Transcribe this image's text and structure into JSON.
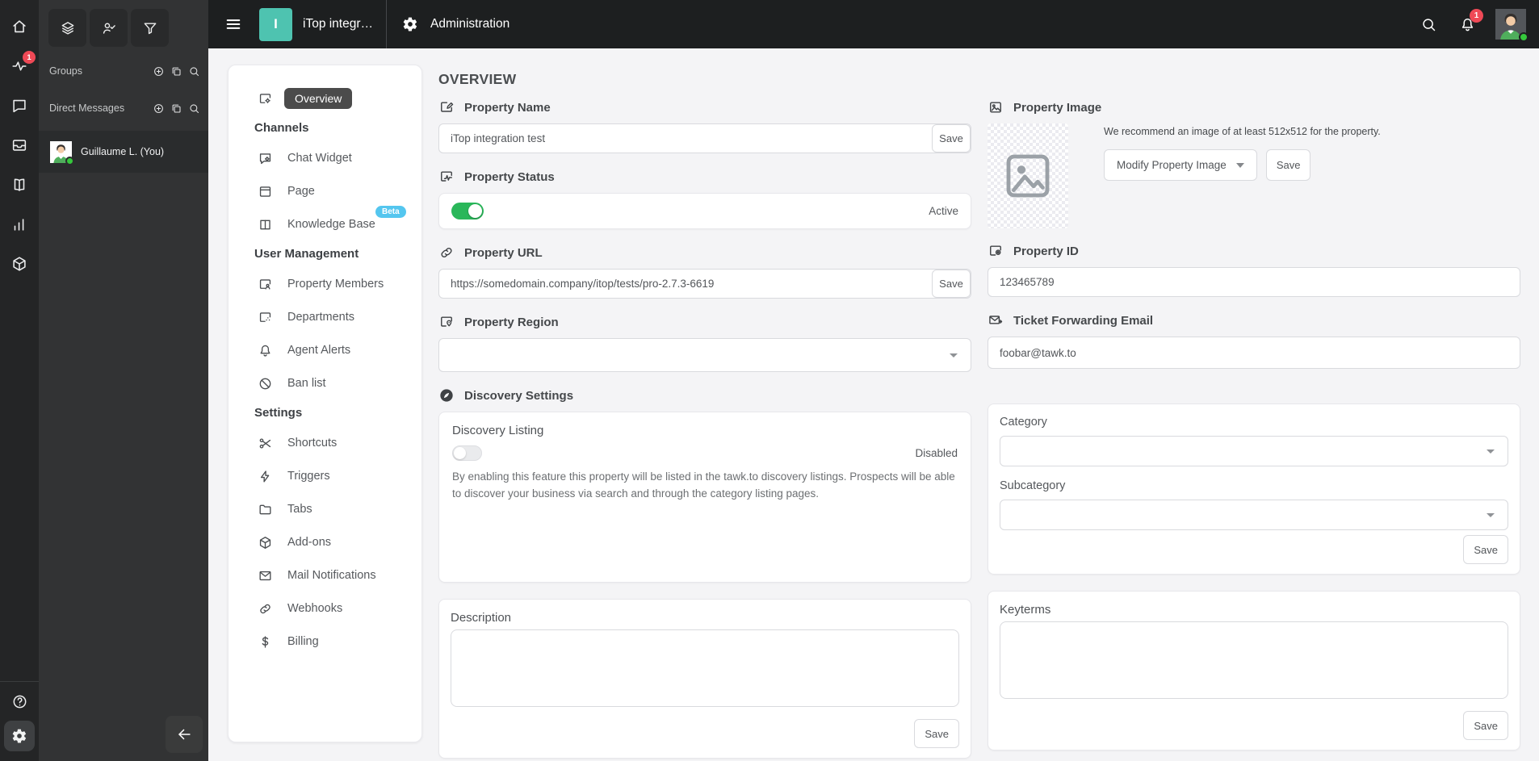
{
  "colors": {
    "brand_teal": "#4ec3b0",
    "toggle_on_green": "#2ab75a",
    "notification_red": "#ef4956",
    "beta_blue": "#54c6ef",
    "active_nav_pill": "#4b4b4b",
    "online_green": "#35c83c"
  },
  "topbar": {
    "property_initial": "I",
    "property_title": "iTop integr…",
    "section_title": "Administration",
    "notification_count": "1"
  },
  "rail": {
    "items": [
      {
        "name": "home",
        "icon": "home"
      },
      {
        "name": "monitoring",
        "icon": "activity",
        "badge": "1"
      },
      {
        "name": "chats",
        "icon": "chat"
      },
      {
        "name": "inbox",
        "icon": "inbox"
      },
      {
        "name": "knowledge-base",
        "icon": "book-open"
      },
      {
        "name": "reporting",
        "icon": "bar-chart"
      },
      {
        "name": "addons",
        "icon": "cube"
      }
    ],
    "bottom": [
      {
        "name": "help",
        "icon": "help-circle"
      },
      {
        "name": "administration",
        "icon": "gear",
        "active": true
      }
    ]
  },
  "panel": {
    "top_buttons": [
      {
        "name": "channels",
        "icon": "layers"
      },
      {
        "name": "agents",
        "icon": "person-check"
      },
      {
        "name": "filters",
        "icon": "filter"
      }
    ],
    "sections": [
      {
        "label": "Groups",
        "actions": [
          {
            "name": "add-group",
            "icon": "circle-plus"
          },
          {
            "name": "duplicate-group",
            "icon": "copy"
          },
          {
            "name": "search-groups",
            "icon": "search"
          }
        ]
      },
      {
        "label": "Direct Messages",
        "actions": [
          {
            "name": "add-direct-message",
            "icon": "circle-plus"
          },
          {
            "name": "duplicate-direct-message",
            "icon": "copy"
          },
          {
            "name": "search-direct-messages",
            "icon": "search"
          }
        ]
      }
    ],
    "user": {
      "name": "Guillaume L. (You)",
      "status": "online"
    }
  },
  "nav": {
    "overview": {
      "label": "Overview",
      "icon": "overview"
    },
    "sections": [
      {
        "header": "Channels",
        "items": [
          {
            "label": "Chat Widget",
            "icon": "chat-widget"
          },
          {
            "label": "Page",
            "icon": "page"
          },
          {
            "label": "Knowledge Base",
            "icon": "book",
            "badge": "Beta"
          }
        ]
      },
      {
        "header": "User Management",
        "items": [
          {
            "label": "Property Members",
            "icon": "window-person"
          },
          {
            "label": "Departments",
            "icon": "window-dots"
          },
          {
            "label": "Agent Alerts",
            "icon": "bell"
          },
          {
            "label": "Ban list",
            "icon": "ban"
          }
        ]
      },
      {
        "header": "Settings",
        "items": [
          {
            "label": "Shortcuts",
            "icon": "scissors"
          },
          {
            "label": "Triggers",
            "icon": "zap"
          },
          {
            "label": "Tabs",
            "icon": "folder"
          },
          {
            "label": "Add-ons",
            "icon": "cube"
          },
          {
            "label": "Mail Notifications",
            "icon": "mail"
          },
          {
            "label": "Webhooks",
            "icon": "link"
          },
          {
            "label": "Billing",
            "icon": "dollar"
          }
        ]
      }
    ]
  },
  "main": {
    "title": "OVERVIEW",
    "property_name": {
      "label": "Property Name",
      "icon": "pencil-square",
      "value": "iTop integration test",
      "save_label": "Save"
    },
    "property_status": {
      "label": "Property Status",
      "icon": "pulse-square",
      "state": "Active"
    },
    "property_url": {
      "label": "Property URL",
      "icon": "link",
      "value": "https://somedomain.company/itop/tests/pro-2.7.3-6619",
      "save_label": "Save"
    },
    "property_region": {
      "label": "Property Region",
      "icon": "pin-square",
      "value": ""
    },
    "discovery": {
      "label": "Discovery Settings",
      "icon": "compass",
      "listing_title": "Discovery Listing",
      "state": "Disabled",
      "description": "By enabling this feature this property will be listed in the tawk.to discovery listings. Prospects will be able to discover your business via search and through the category listing pages."
    },
    "description_card": {
      "title": "Description",
      "value": "",
      "save_label": "Save"
    },
    "property_image": {
      "label": "Property Image",
      "icon": "image-square",
      "hint": "We recommend an image of at least 512x512 for the property.",
      "modify_label": "Modify Property Image",
      "save_label": "Save"
    },
    "property_id": {
      "label": "Property ID",
      "icon": "fingerprint-square",
      "value": "123465789"
    },
    "ticket_email": {
      "label": "Ticket Forwarding Email",
      "icon": "mail-forward",
      "value": "foobar@tawk.to"
    },
    "category_card": {
      "category_label": "Category",
      "subcategory_label": "Subcategory",
      "save_label": "Save"
    },
    "keyterms_card": {
      "title": "Keyterms",
      "value": "",
      "save_label": "Save"
    }
  }
}
